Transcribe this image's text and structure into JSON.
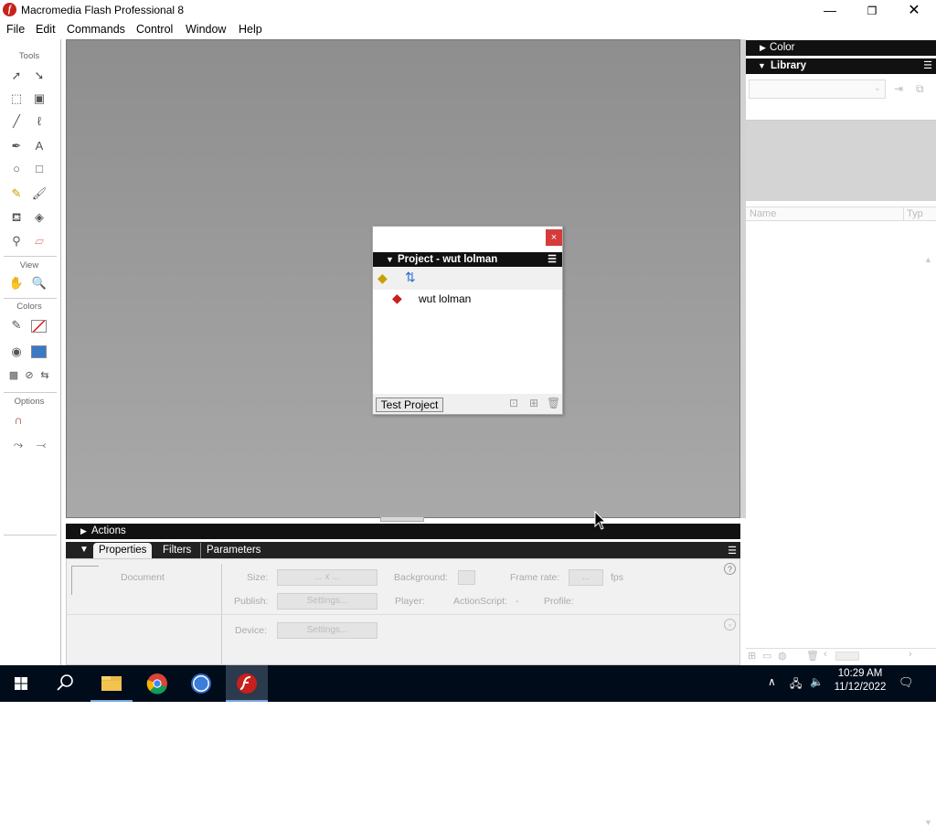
{
  "app": {
    "title": "Macromedia Flash Professional 8",
    "icon": "flash-icon",
    "window_controls": [
      "minimize-icon",
      "restore-icon",
      "close-icon"
    ]
  },
  "menu": [
    "File",
    "Edit",
    "Commands",
    "Control",
    "Window",
    "Help"
  ],
  "tools_panel": {
    "sections": {
      "tools": "Tools",
      "view": "View",
      "colors": "Colors",
      "options": "Options"
    }
  },
  "project_panel": {
    "title": "Project - wut lolman",
    "item": "wut lolman",
    "test_button": "Test Project"
  },
  "actions_panel": {
    "label": "Actions"
  },
  "properties_panel": {
    "tabs": [
      "Properties",
      "Filters",
      "Parameters"
    ],
    "document_label": "Document",
    "size_label": "Size:",
    "size_value": "... x ...",
    "background_label": "Background:",
    "frame_rate_label": "Frame rate:",
    "frame_rate_value": "...",
    "fps_label": "fps",
    "publish_label": "Publish:",
    "settings_label": "Settings...",
    "player_label": "Player:",
    "actionscript_label": "ActionScript:",
    "actionscript_value": "-",
    "profile_label": "Profile:",
    "device_label": "Device:",
    "device_settings_label": "Settings..."
  },
  "right_panels": {
    "color": "Color",
    "library": "Library",
    "name_header": "Name",
    "type_header": "Typ"
  },
  "taskbar": {
    "time": "10:29 AM",
    "date": "11/12/2022",
    "apps": [
      "windows-start-icon",
      "search-icon",
      "file-explorer-icon",
      "chrome-icon",
      "ffdec-icon",
      "flash-icon"
    ]
  },
  "colors": {
    "accent_red": "#c8201b",
    "panel_header": "#111111",
    "taskbar": "#000c1a"
  }
}
